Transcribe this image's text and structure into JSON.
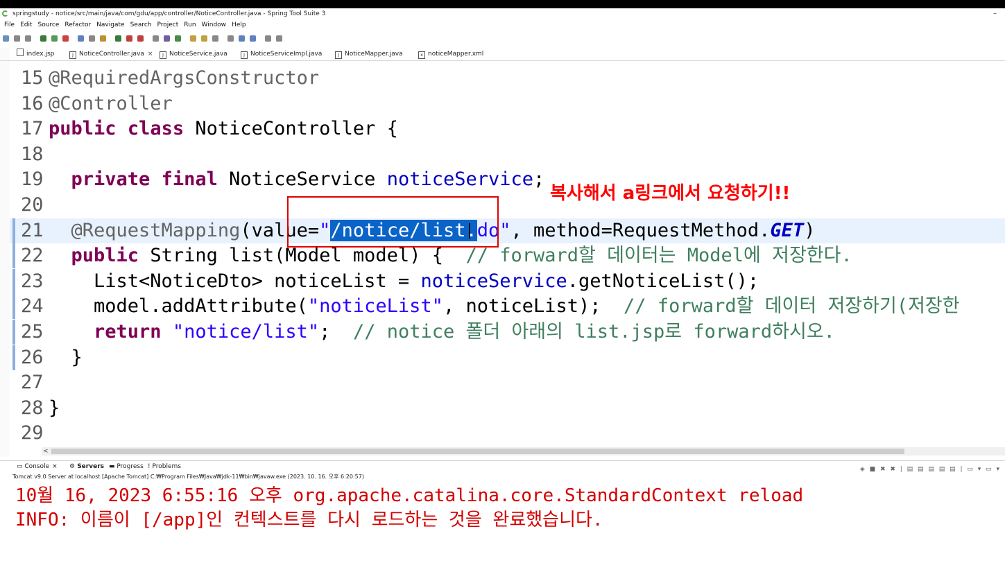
{
  "window": {
    "title": "springstudy - notice/src/main/java/com/gdu/app/controller/NoticeController.java - Spring Tool Suite 3",
    "minimize": "–"
  },
  "menu": [
    "File",
    "Edit",
    "Source",
    "Refactor",
    "Navigate",
    "Search",
    "Project",
    "Run",
    "Window",
    "Help"
  ],
  "tabs": [
    {
      "label": "index.jsp",
      "icon": "file-icon",
      "active": false
    },
    {
      "label": "NoticeController.java",
      "icon": "java-file-icon",
      "active": true,
      "close": "×"
    },
    {
      "label": "NoticeService.java",
      "icon": "java-file-icon",
      "active": false
    },
    {
      "label": "NoticeServiceImpl.java",
      "icon": "java-file-icon",
      "active": false
    },
    {
      "label": "NoticeMapper.java",
      "icon": "java-file-icon",
      "active": false
    },
    {
      "label": "noticeMapper.xml",
      "icon": "xml-file-icon",
      "active": false
    }
  ],
  "editor": {
    "lines": [
      {
        "num": "15",
        "parts": [
          [
            "ann",
            "@RequiredArgsConstructor"
          ]
        ]
      },
      {
        "num": "16",
        "parts": [
          [
            "ann",
            "@Controller"
          ]
        ]
      },
      {
        "num": "17",
        "parts": [
          [
            "kw",
            "public"
          ],
          [
            "",
            " "
          ],
          [
            "kw",
            "class"
          ],
          [
            "",
            " NoticeController {"
          ]
        ]
      },
      {
        "num": "18",
        "parts": []
      },
      {
        "num": "19",
        "parts": [
          [
            "",
            "  "
          ],
          [
            "kw",
            "private"
          ],
          [
            "",
            " "
          ],
          [
            "kw",
            "final"
          ],
          [
            "",
            " NoticeService "
          ],
          [
            "fld",
            "noticeService"
          ],
          [
            "",
            ";"
          ]
        ]
      },
      {
        "num": "20",
        "parts": []
      },
      {
        "num": "21",
        "parts": [
          [
            "",
            "  "
          ],
          [
            "ann",
            "@RequestMapping"
          ],
          [
            "",
            "(value="
          ],
          [
            "str",
            "\""
          ],
          [
            "sel",
            "/notice/list."
          ],
          [
            "str",
            "do\""
          ],
          [
            "",
            ", method=RequestMethod."
          ],
          [
            "static",
            "GET"
          ],
          [
            "",
            ")"
          ]
        ],
        "current": true
      },
      {
        "num": "22",
        "parts": [
          [
            "",
            "  "
          ],
          [
            "kw",
            "public"
          ],
          [
            "",
            " String list(Model model) {  "
          ],
          [
            "cmt",
            "// forward할 데이터는 Model에 저장한다."
          ]
        ]
      },
      {
        "num": "23",
        "parts": [
          [
            "",
            "    List<NoticeDto> noticeList = "
          ],
          [
            "fld",
            "noticeService"
          ],
          [
            "",
            ".getNoticeList();"
          ]
        ]
      },
      {
        "num": "24",
        "parts": [
          [
            "",
            "    model.addAttribute("
          ],
          [
            "str",
            "\"noticeList\""
          ],
          [
            "",
            ", noticeList);  "
          ],
          [
            "cmt",
            "// forward할 데이터 저장하기(저장한"
          ]
        ]
      },
      {
        "num": "25",
        "parts": [
          [
            "",
            "    "
          ],
          [
            "kw",
            "return"
          ],
          [
            "",
            " "
          ],
          [
            "str",
            "\"notice/list\""
          ],
          [
            "",
            ";  "
          ],
          [
            "cmt",
            "// notice 폴더 아래의 list.jsp로 forward하시오."
          ]
        ]
      },
      {
        "num": "26",
        "parts": [
          [
            "",
            "  }"
          ]
        ]
      },
      {
        "num": "27",
        "parts": []
      },
      {
        "num": "28",
        "parts": [
          [
            "",
            "}"
          ]
        ]
      },
      {
        "num": "29",
        "parts": []
      }
    ]
  },
  "overlay_note": "복사해서 a링크에서 요청하기!!",
  "console": {
    "tabs": [
      {
        "label": "Console",
        "close": "×"
      },
      {
        "label": "Servers",
        "active": true
      },
      {
        "label": "Progress"
      },
      {
        "label": "Problems"
      }
    ],
    "server_info": "Tomcat v9.0 Server at localhost [Apache Tomcat] C:₩Program Files₩Java₩jdk-11₩bin₩javaw.exe  (2023. 10. 16. 오후 6:20:57)",
    "output": [
      "10월 16, 2023 6:55:16 오후 org.apache.catalina.core.StandardContext reload",
      "INFO: 이름이 [/app]인 컨텍스트를 다시 로드하는 것을 완료했습니다."
    ]
  },
  "colors": {
    "keyword": "#7f0055",
    "annotation": "#646464",
    "string": "#2a00ff",
    "comment": "#3f7f5f",
    "field": "#0000c0",
    "selection": "#0a64c8",
    "console_error": "#d30000",
    "highlight_box": "#e00000"
  }
}
